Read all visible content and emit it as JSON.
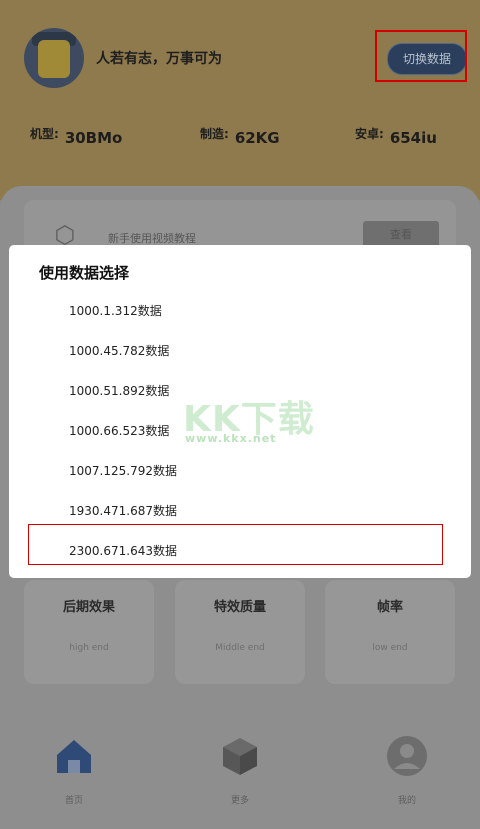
{
  "header": {
    "motto": "人若有志，万事可为",
    "switch_button": "切换数据"
  },
  "specs": [
    {
      "key": "机型:",
      "value": "30BMo"
    },
    {
      "key": "制造:",
      "value": "62KG"
    },
    {
      "key": "安卓:",
      "value": "654iu"
    }
  ],
  "tutorial": {
    "text": "新手使用视频教程",
    "button": "查看"
  },
  "options": [
    {
      "title": "后期效果",
      "sub": "high end"
    },
    {
      "title": "特效质量",
      "sub": "Middle end"
    },
    {
      "title": "帧率",
      "sub": "low end"
    }
  ],
  "nav": [
    {
      "label": "首页",
      "icon": "home-icon"
    },
    {
      "label": "更多",
      "icon": "cube-icon"
    },
    {
      "label": "我的",
      "icon": "profile-icon"
    }
  ],
  "dialog": {
    "title": "使用数据选择",
    "items": [
      "1000.1.312数据",
      "1000.45.782数据",
      "1000.51.892数据",
      "1000.66.523数据",
      "1007.125.792数据",
      "1930.471.687数据",
      "2300.671.643数据"
    ]
  },
  "watermark": {
    "text": "KK下载",
    "url": "www.kkx.net"
  },
  "colors": {
    "header_bg": "#8f7a4d",
    "accent_button": "#2b3f5c",
    "highlight_frame": "#d40000",
    "dialog_bg": "#ffffff"
  }
}
